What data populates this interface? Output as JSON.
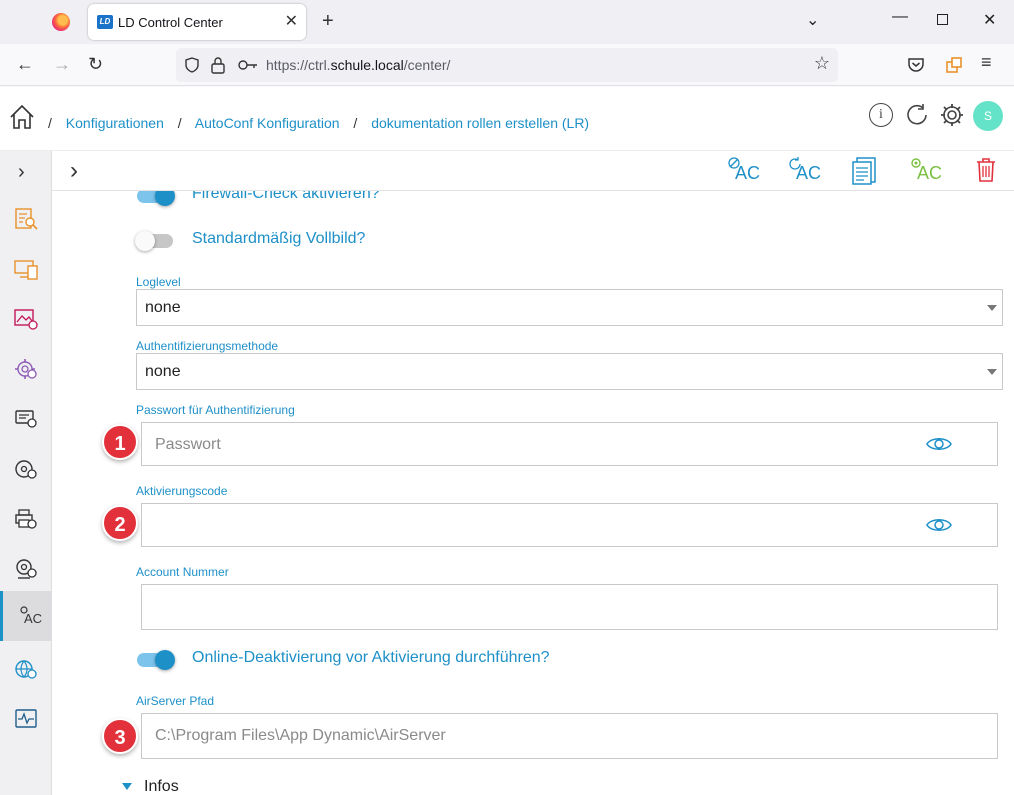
{
  "browser": {
    "tab_title": "LD Control Center",
    "tab_favicon_text": "LD",
    "url_prefix": "https://ctrl.",
    "url_host": "schule.local",
    "url_path": "/center/"
  },
  "breadcrumb": {
    "items": [
      "Konfigurationen",
      "AutoConf Konfiguration",
      "dokumentation rollen erstellen (LR)"
    ],
    "separator": "/"
  },
  "header": {
    "avatar_initial": "S"
  },
  "sidebar": {
    "items": [
      "search-list-icon",
      "devices-icon",
      "image-settings-icon",
      "gear-settings-icon",
      "device-settings-icon",
      "disc-settings-icon",
      "printer-settings-icon",
      "camera-settings-icon",
      "autoconf-icon",
      "network-settings-icon",
      "monitor-icon"
    ],
    "active_index": 8,
    "autoconf_label": "AC"
  },
  "toolbar": {
    "ac_label": "AC"
  },
  "form": {
    "toggle_firewall": "Firewall-Check aktivieren?",
    "toggle_fullscreen": "Standardmäßig Vollbild?",
    "loglevel_label": "Loglevel",
    "loglevel_value": "none",
    "auth_label": "Authentifizierungsmethode",
    "auth_value": "none",
    "password_label": "Passwort für Authentifizierung",
    "password_placeholder": "Passwort",
    "activation_label": "Aktivierungscode",
    "activation_value": "",
    "account_label": "Account Nummer",
    "account_value": "",
    "toggle_deactivation": "Online-Deaktivierung vor Aktivierung durchführen?",
    "airserver_label": "AirServer Pfad",
    "airserver_value": "C:\\Program Files\\App Dynamic\\AirServer",
    "infos_label": "Infos"
  },
  "badges": [
    "1",
    "2",
    "3"
  ],
  "colors": {
    "accent": "#1e90c8",
    "badge": "#e2313b",
    "avatar": "#64e3c8",
    "delete": "#e2313b",
    "ac_green": "#7bc043"
  }
}
